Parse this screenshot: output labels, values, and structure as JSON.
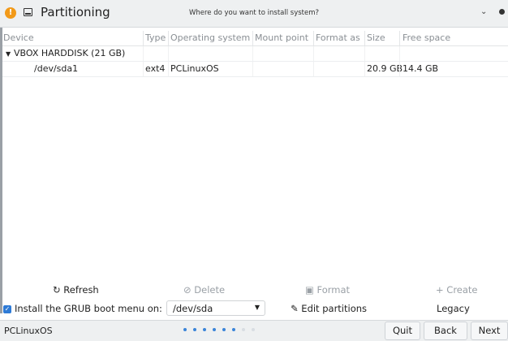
{
  "window": {
    "title": "Partitioning",
    "question": "Where do you want to install system?"
  },
  "table": {
    "headers": [
      "Device",
      "Type",
      "Operating system",
      "Mount point",
      "Format as",
      "Size",
      "Free space"
    ],
    "rows": [
      {
        "device": "VBOX HARDDISK (21 GB)",
        "type": "",
        "os": "",
        "mount": "",
        "format": "",
        "size": "",
        "free": ""
      },
      {
        "device": "/dev/sda1",
        "type": "ext4",
        "os": "PCLinuxOS",
        "mount": "",
        "format": "",
        "size": "20.9 GB",
        "free": "14.4 GB"
      }
    ]
  },
  "actions": {
    "refresh": "Refresh",
    "delete": "Delete",
    "format": "Format",
    "create": "+ Create"
  },
  "grub": {
    "label": "Install the GRUB boot menu on:",
    "device": "/dev/sda",
    "edit": "Edit partitions",
    "mode": "Legacy"
  },
  "status": {
    "distro": "PCLinuxOS",
    "progress_step": 6,
    "progress_total": 8
  },
  "nav": {
    "quit": "Quit",
    "back": "Back",
    "next": "Next"
  },
  "colors": {
    "accent": "#2f7bd6",
    "app_icon": "#f29a19"
  }
}
